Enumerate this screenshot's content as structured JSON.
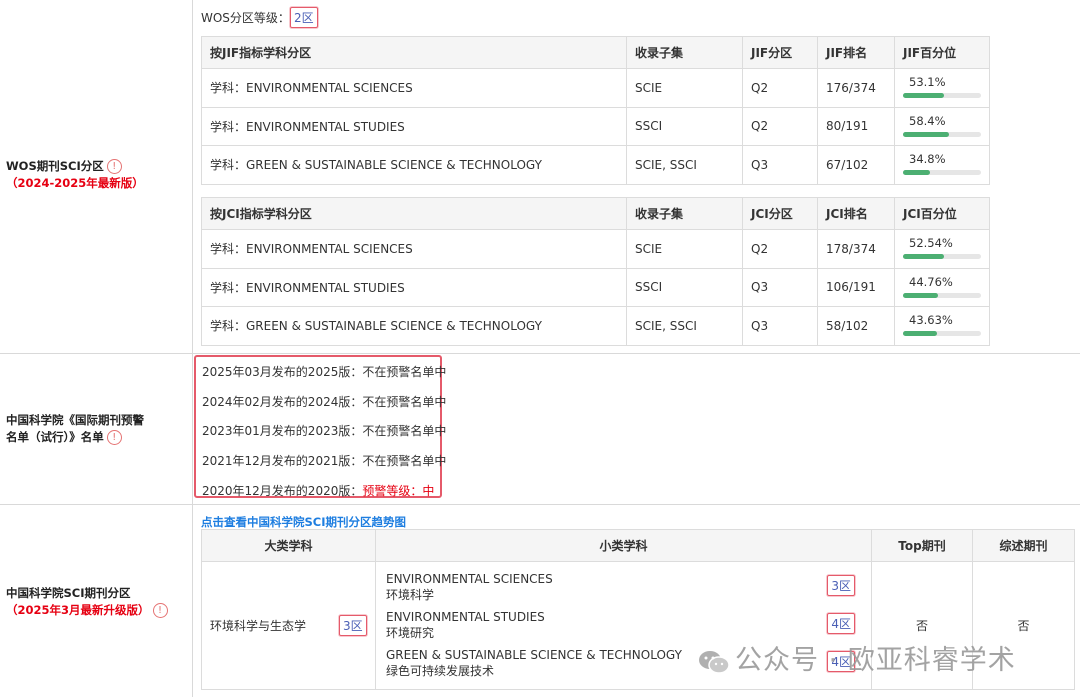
{
  "wos": {
    "label_line1": "WOS期刊SCI分区",
    "label_line2": "（2024-2025年最新版）",
    "grade_label": "WOS分区等级：",
    "grade_value": "2区",
    "jif_table": {
      "headers": [
        "按JIF指标学科分区",
        "收录子集",
        "JIF分区",
        "JIF排名",
        "JIF百分位"
      ],
      "rows": [
        {
          "subject": "学科：ENVIRONMENTAL SCIENCES",
          "subset": "SCIE",
          "zone": "Q2",
          "rank": "176/374",
          "pct": "53.1%",
          "pct_value": 53.1
        },
        {
          "subject": "学科：ENVIRONMENTAL STUDIES",
          "subset": "SSCI",
          "zone": "Q2",
          "rank": "80/191",
          "pct": "58.4%",
          "pct_value": 58.4
        },
        {
          "subject": "学科：GREEN & SUSTAINABLE SCIENCE & TECHNOLOGY",
          "subset": "SCIE, SSCI",
          "zone": "Q3",
          "rank": "67/102",
          "pct": "34.8%",
          "pct_value": 34.8
        }
      ]
    },
    "jci_table": {
      "headers": [
        "按JCI指标学科分区",
        "收录子集",
        "JCI分区",
        "JCI排名",
        "JCI百分位"
      ],
      "rows": [
        {
          "subject": "学科：ENVIRONMENTAL SCIENCES",
          "subset": "SCIE",
          "zone": "Q2",
          "rank": "178/374",
          "pct": "52.54%",
          "pct_value": 52.54
        },
        {
          "subject": "学科：ENVIRONMENTAL STUDIES",
          "subset": "SSCI",
          "zone": "Q3",
          "rank": "106/191",
          "pct": "44.76%",
          "pct_value": 44.76
        },
        {
          "subject": "学科：GREEN & SUSTAINABLE SCIENCE & TECHNOLOGY",
          "subset": "SCIE, SSCI",
          "zone": "Q3",
          "rank": "58/102",
          "pct": "43.63%",
          "pct_value": 43.63
        }
      ]
    }
  },
  "warning": {
    "label_line1": "中国科学院《国际期刊预警",
    "label_line2": "名单（试行）》名单",
    "lines": [
      {
        "text": "2025年03月发布的2025版：不在预警名单中",
        "highlight": ""
      },
      {
        "text": "2024年02月发布的2024版：不在预警名单中",
        "highlight": ""
      },
      {
        "text": "2023年01月发布的2023版：不在预警名单中",
        "highlight": ""
      },
      {
        "text": "2021年12月发布的2021版：不在预警名单中",
        "highlight": ""
      },
      {
        "text": "2020年12月发布的2020版：",
        "highlight": "预警等级：中"
      }
    ]
  },
  "cas": {
    "label_line1": "中国科学院SCI期刊分区",
    "label_line2": "（2025年3月最新升级版）",
    "trend_link": "点击查看中国科学院SCI期刊分区趋势图",
    "headers": [
      "大类学科",
      "小类学科",
      "Top期刊",
      "综述期刊"
    ],
    "major": "环境科学与生态学",
    "major_zone": "3区",
    "minors": [
      {
        "en": "ENVIRONMENTAL SCIENCES",
        "zh": "环境科学",
        "zone": "3区"
      },
      {
        "en": "ENVIRONMENTAL STUDIES",
        "zh": "环境研究",
        "zone": "4区"
      },
      {
        "en": "GREEN & SUSTAINABLE SCIENCE & TECHNOLOGY",
        "zh": "绿色可持续发展技术",
        "zone": "4区"
      }
    ],
    "top": "否",
    "review": "否"
  },
  "watermark": "公众号 · 欧亚科睿学术",
  "colors": {
    "accent_red": "#e60012",
    "link_blue": "#1e7ee0",
    "bar_green": "#4caf72",
    "badge_border": "#e55a6a"
  },
  "icons": {
    "info": "info-circle-icon",
    "wechat": "wechat-icon"
  }
}
